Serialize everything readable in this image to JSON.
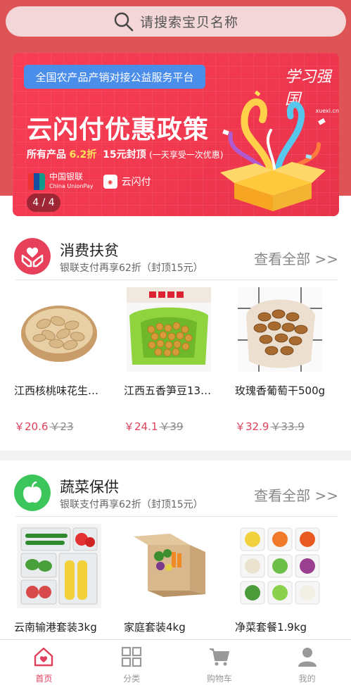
{
  "search": {
    "placeholder": "请搜索宝贝名称"
  },
  "banner": {
    "top_tag": "全国农产品产销对接公益服务平台",
    "title": "云闪付优惠政策",
    "sub_prefix": "所有产品",
    "sub_discount": "6.2折",
    "sub_cap": "15元封顶",
    "sub_note": "(一天享受一次优惠)",
    "unionpay_cn": "中国银联",
    "unionpay_en": "China UnionPay",
    "ysf_label": "云闪付",
    "brand": "学习强国",
    "brand_url": "xuexi.cn",
    "pager": "4 / 4"
  },
  "sections": [
    {
      "title": "消费扶贫",
      "subtitle": "银联支付再享62折（封顶15元）",
      "see_all": "查看全部 >>",
      "items": [
        {
          "name": "江西核桃味花生…",
          "price": "￥20.6",
          "old_price": "￥23"
        },
        {
          "name": "江西五香笋豆13…",
          "price": "￥24.1",
          "old_price": "￥39"
        },
        {
          "name": "玫瑰香葡萄干500g",
          "price": "￥32.9",
          "old_price": "￥33.9"
        }
      ]
    },
    {
      "title": "蔬菜保供",
      "subtitle": "银联支付再享62折（封顶15元）",
      "see_all": "查看全部 >>",
      "items": [
        {
          "name": "云南输港套装3kg"
        },
        {
          "name": "家庭套装4kg"
        },
        {
          "name": "净菜套餐1.9kg"
        }
      ]
    }
  ],
  "tabbar": {
    "items": [
      {
        "label": "首页",
        "active": true
      },
      {
        "label": "分类",
        "active": false
      },
      {
        "label": "购物车",
        "active": false
      },
      {
        "label": "我的",
        "active": false
      }
    ]
  },
  "colors": {
    "header": "#de5356",
    "accent": "#e0405b",
    "section1_icon": "#e8405a",
    "section2_icon": "#3cc55a"
  }
}
